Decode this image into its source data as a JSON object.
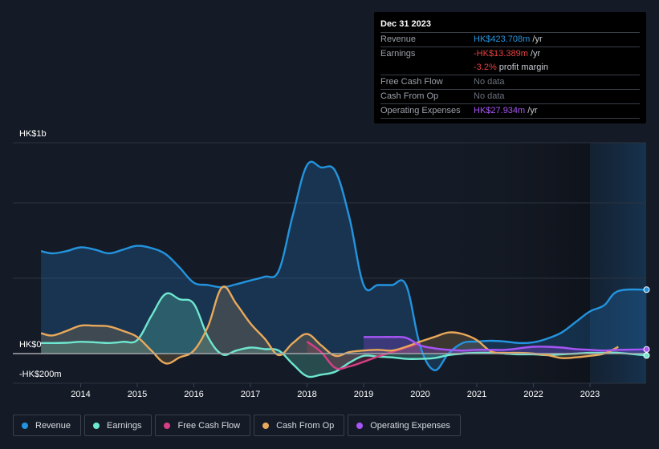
{
  "tooltip": {
    "date": "Dec 31 2023",
    "rows": [
      {
        "label": "Revenue",
        "value": "HK$423.708m",
        "unit": " /yr",
        "color": "#2394df"
      },
      {
        "label": "Earnings",
        "value": "-HK$13.389m",
        "unit": " /yr",
        "color": "#e64141"
      },
      {
        "label": "",
        "value": "-3.2%",
        "unit": " profit margin",
        "color": "#e64141"
      },
      {
        "label": "Free Cash Flow",
        "value": "No data",
        "unit": "",
        "color": "#6b717b"
      },
      {
        "label": "Cash From Op",
        "value": "No data",
        "unit": "",
        "color": "#6b717b"
      },
      {
        "label": "Operating Expenses",
        "value": "HK$27.934m",
        "unit": " /yr",
        "color": "#a855f7"
      }
    ]
  },
  "legend": [
    {
      "label": "Revenue",
      "color": "#2394df"
    },
    {
      "label": "Earnings",
      "color": "#6ee7d0"
    },
    {
      "label": "Free Cash Flow",
      "color": "#d63f85"
    },
    {
      "label": "Cash From Op",
      "color": "#e9a95a"
    },
    {
      "label": "Operating Expenses",
      "color": "#a855f7"
    }
  ],
  "chart_data": {
    "type": "area",
    "title": "",
    "xlabel": "",
    "ylabel": "",
    "y_axis_labels": [
      "HK$1b",
      "HK$0",
      "-HK$200m"
    ],
    "x_tick_labels": [
      "2014",
      "2015",
      "2016",
      "2017",
      "2018",
      "2019",
      "2020",
      "2021",
      "2022",
      "2023"
    ],
    "xlim": [
      2013.3,
      2024.0
    ],
    "ylim": [
      -200,
      1400
    ],
    "grid": true,
    "legend_position": "bottom",
    "forecast_shaded_from": 2023.0,
    "series": [
      {
        "name": "Revenue",
        "color": "#2394df",
        "x": [
          2013.3,
          2013.5,
          2013.75,
          2014.0,
          2014.25,
          2014.5,
          2014.75,
          2015.0,
          2015.25,
          2015.5,
          2015.75,
          2016.0,
          2016.25,
          2016.5,
          2016.75,
          2017.0,
          2017.25,
          2017.5,
          2017.75,
          2018.0,
          2018.25,
          2018.5,
          2018.75,
          2019.0,
          2019.25,
          2019.5,
          2019.75,
          2020.0,
          2020.25,
          2020.5,
          2020.75,
          2021.0,
          2021.25,
          2021.5,
          2021.75,
          2022.0,
          2022.25,
          2022.5,
          2022.75,
          2023.0,
          2023.25,
          2023.5,
          2024.0
        ],
        "values": [
          680,
          665,
          680,
          705,
          690,
          665,
          690,
          715,
          700,
          660,
          570,
          470,
          455,
          440,
          460,
          485,
          510,
          550,
          920,
          1250,
          1235,
          1210,
          900,
          455,
          455,
          455,
          455,
          50,
          -110,
          0,
          70,
          80,
          85,
          80,
          70,
          75,
          100,
          140,
          210,
          280,
          320,
          415,
          424
        ]
      },
      {
        "name": "Earnings",
        "color": "#6ee7d0",
        "x": [
          2013.3,
          2013.5,
          2013.75,
          2014.0,
          2014.25,
          2014.5,
          2014.75,
          2015.0,
          2015.25,
          2015.5,
          2015.75,
          2016.0,
          2016.25,
          2016.5,
          2016.75,
          2017.0,
          2017.25,
          2017.5,
          2017.75,
          2018.0,
          2018.25,
          2018.5,
          2018.75,
          2019.0,
          2019.25,
          2019.5,
          2019.75,
          2020.0,
          2020.25,
          2020.5,
          2020.75,
          2021.0,
          2021.25,
          2021.5,
          2021.75,
          2022.0,
          2022.25,
          2022.5,
          2022.75,
          2023.0,
          2023.25,
          2023.5,
          2024.0
        ],
        "values": [
          70,
          70,
          72,
          78,
          75,
          70,
          78,
          90,
          250,
          395,
          360,
          330,
          110,
          -5,
          20,
          40,
          30,
          20,
          -70,
          -150,
          -140,
          -120,
          -60,
          -15,
          -20,
          -25,
          -35,
          -35,
          -30,
          -10,
          0,
          5,
          5,
          0,
          -5,
          -5,
          -10,
          -5,
          0,
          5,
          5,
          5,
          -13
        ]
      },
      {
        "name": "Free Cash Flow",
        "color": "#d63f85",
        "x": [
          2018.0,
          2018.25,
          2018.5,
          2018.75,
          2019.0,
          2019.25,
          2019.5,
          2019.75,
          2020.0
        ],
        "values": [
          80,
          10,
          -95,
          -85,
          -55,
          -20,
          10,
          40,
          70
        ]
      },
      {
        "name": "Cash From Op",
        "color": "#e9a95a",
        "x": [
          2013.3,
          2013.5,
          2013.75,
          2014.0,
          2014.25,
          2014.5,
          2014.75,
          2015.0,
          2015.25,
          2015.5,
          2015.75,
          2016.0,
          2016.25,
          2016.5,
          2016.75,
          2017.0,
          2017.25,
          2017.5,
          2017.75,
          2018.0,
          2018.25,
          2018.5,
          2018.75,
          2019.0,
          2019.25,
          2019.5,
          2019.75,
          2020.0,
          2020.25,
          2020.5,
          2020.75,
          2021.0,
          2021.25,
          2021.5,
          2021.75,
          2022.0,
          2022.25,
          2022.5,
          2022.75,
          2023.0,
          2023.25,
          2023.5
        ],
        "values": [
          135,
          120,
          150,
          185,
          185,
          180,
          150,
          110,
          20,
          -65,
          -25,
          20,
          180,
          440,
          330,
          200,
          100,
          -10,
          70,
          130,
          55,
          -15,
          10,
          20,
          25,
          20,
          45,
          80,
          110,
          140,
          130,
          90,
          15,
          5,
          5,
          0,
          -10,
          -30,
          -25,
          -15,
          0,
          45
        ]
      },
      {
        "name": "Operating Expenses",
        "color": "#a855f7",
        "x": [
          2019.0,
          2019.25,
          2019.5,
          2019.75,
          2020.0,
          2020.25,
          2020.5,
          2020.75,
          2021.0,
          2021.25,
          2021.5,
          2021.75,
          2022.0,
          2022.25,
          2022.5,
          2022.75,
          2023.0,
          2023.25,
          2023.5,
          2024.0
        ],
        "values": [
          110,
          110,
          110,
          105,
          55,
          35,
          25,
          20,
          25,
          25,
          25,
          35,
          45,
          45,
          40,
          30,
          25,
          20,
          25,
          28
        ]
      }
    ]
  }
}
